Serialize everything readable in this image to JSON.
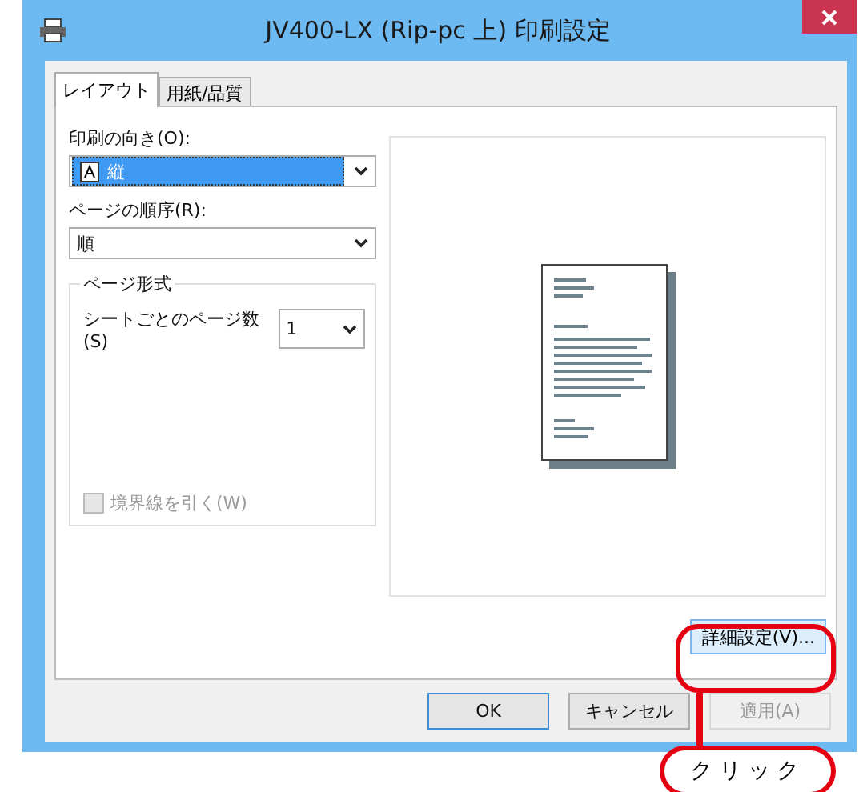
{
  "window": {
    "title": "JV400-LX (Rip-pc 上) 印刷設定"
  },
  "tabs": [
    {
      "label": "レイアウト",
      "selected": true
    },
    {
      "label": "用紙/品質",
      "selected": false
    }
  ],
  "orientation": {
    "label": "印刷の向き(O):",
    "value": "縦"
  },
  "page_order": {
    "label": "ページの順序(R):",
    "value": "順"
  },
  "page_format": {
    "title": "ページ形式",
    "pages_per_sheet_label": "シートごとのページ数(S)",
    "pages_per_sheet": "1",
    "border": {
      "label": "境界線を引く(W)",
      "checked": false,
      "disabled": true
    }
  },
  "advanced_button": "詳細設定(V)...",
  "buttons": [
    {
      "label": "OK",
      "disabled": false
    },
    {
      "label": "キャンセル",
      "disabled": false
    },
    {
      "label": "適用(A)",
      "disabled": true
    }
  ],
  "callout": "クリック"
}
